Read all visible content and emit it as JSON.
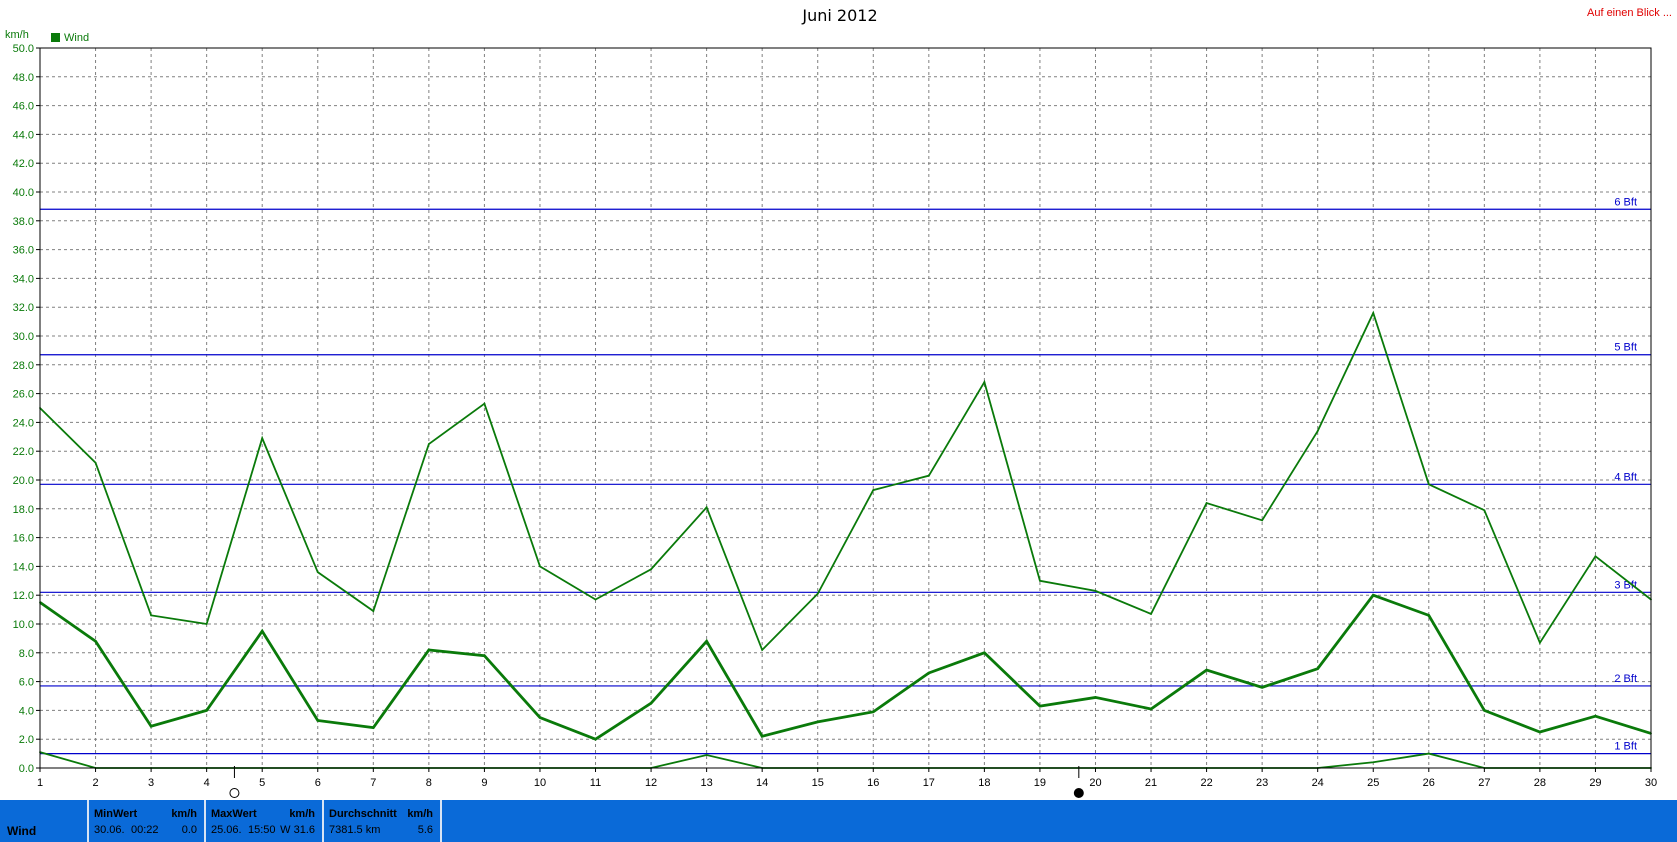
{
  "header": {
    "title": "Juni 2012",
    "link_text": "Auf einen Blick ..."
  },
  "colors": {
    "series": "#0a7a0a",
    "beaufort": "#0000cc",
    "grid": "#808080",
    "link": "#e00000",
    "statusbar": "#0a6ad8"
  },
  "chart_data": {
    "type": "line",
    "title": "Juni 2012",
    "ylabel": "km/h",
    "xlabel": "",
    "ylim": [
      0,
      50
    ],
    "ytick_step": 2,
    "x": [
      1,
      2,
      3,
      4,
      5,
      6,
      7,
      8,
      9,
      10,
      11,
      12,
      13,
      14,
      15,
      16,
      17,
      18,
      19,
      20,
      21,
      22,
      23,
      24,
      25,
      26,
      27,
      28,
      29,
      30
    ],
    "legend": [
      "Wind"
    ],
    "series": [
      {
        "name": "Wind",
        "role": "max",
        "values": [
          25.0,
          21.2,
          10.6,
          10.0,
          22.9,
          13.6,
          10.9,
          22.5,
          25.3,
          14.0,
          11.7,
          13.8,
          18.1,
          8.2,
          12.1,
          19.3,
          20.3,
          26.8,
          13.0,
          12.3,
          10.7,
          18.4,
          17.2,
          23.4,
          31.6,
          19.7,
          17.9,
          8.7,
          14.7,
          11.7
        ]
      },
      {
        "name": "Wind",
        "role": "average",
        "values": [
          11.5,
          8.8,
          2.9,
          4.0,
          9.5,
          3.3,
          2.8,
          8.2,
          7.8,
          3.5,
          2.0,
          4.5,
          8.8,
          2.2,
          3.2,
          3.9,
          6.6,
          8.0,
          4.3,
          4.9,
          4.1,
          6.8,
          5.6,
          6.9,
          12.0,
          10.6,
          4.0,
          2.5,
          3.6,
          2.4
        ]
      },
      {
        "name": "Wind",
        "role": "min",
        "values": [
          1.1,
          0.0,
          0.0,
          0.0,
          0.0,
          0.0,
          0.0,
          0.0,
          0.0,
          0.0,
          0.0,
          0.0,
          0.9,
          0.0,
          0.0,
          0.0,
          0.0,
          0.0,
          0.0,
          0.0,
          0.0,
          0.0,
          0.0,
          0.0,
          0.4,
          1.0,
          0.0,
          0.0,
          0.0,
          0.0
        ]
      }
    ],
    "reference_lines": [
      {
        "label": "1 Bft",
        "value": 1.0
      },
      {
        "label": "2 Bft",
        "value": 5.7
      },
      {
        "label": "3 Bft",
        "value": 12.2
      },
      {
        "label": "4 Bft",
        "value": 19.7
      },
      {
        "label": "5 Bft",
        "value": 28.7
      },
      {
        "label": "6 Bft",
        "value": 38.8
      }
    ],
    "moon_phases": [
      {
        "day": 4.5,
        "phase": "full"
      },
      {
        "day": 19.7,
        "phase": "new"
      }
    ],
    "grid": true,
    "legend_position": "top-left"
  },
  "status": {
    "row_label": "Wind",
    "min": {
      "header": "MinWert",
      "unit": "km/h",
      "date": "30.06.",
      "time": "00:22",
      "value": "0.0"
    },
    "max": {
      "header": "MaxWert",
      "unit": "km/h",
      "date": "25.06.",
      "time": "15:50",
      "value": "W 31.6"
    },
    "avg": {
      "header": "Durchschnitt",
      "unit": "km/h",
      "value_left": "7381.5 km",
      "value": "5.6"
    }
  }
}
